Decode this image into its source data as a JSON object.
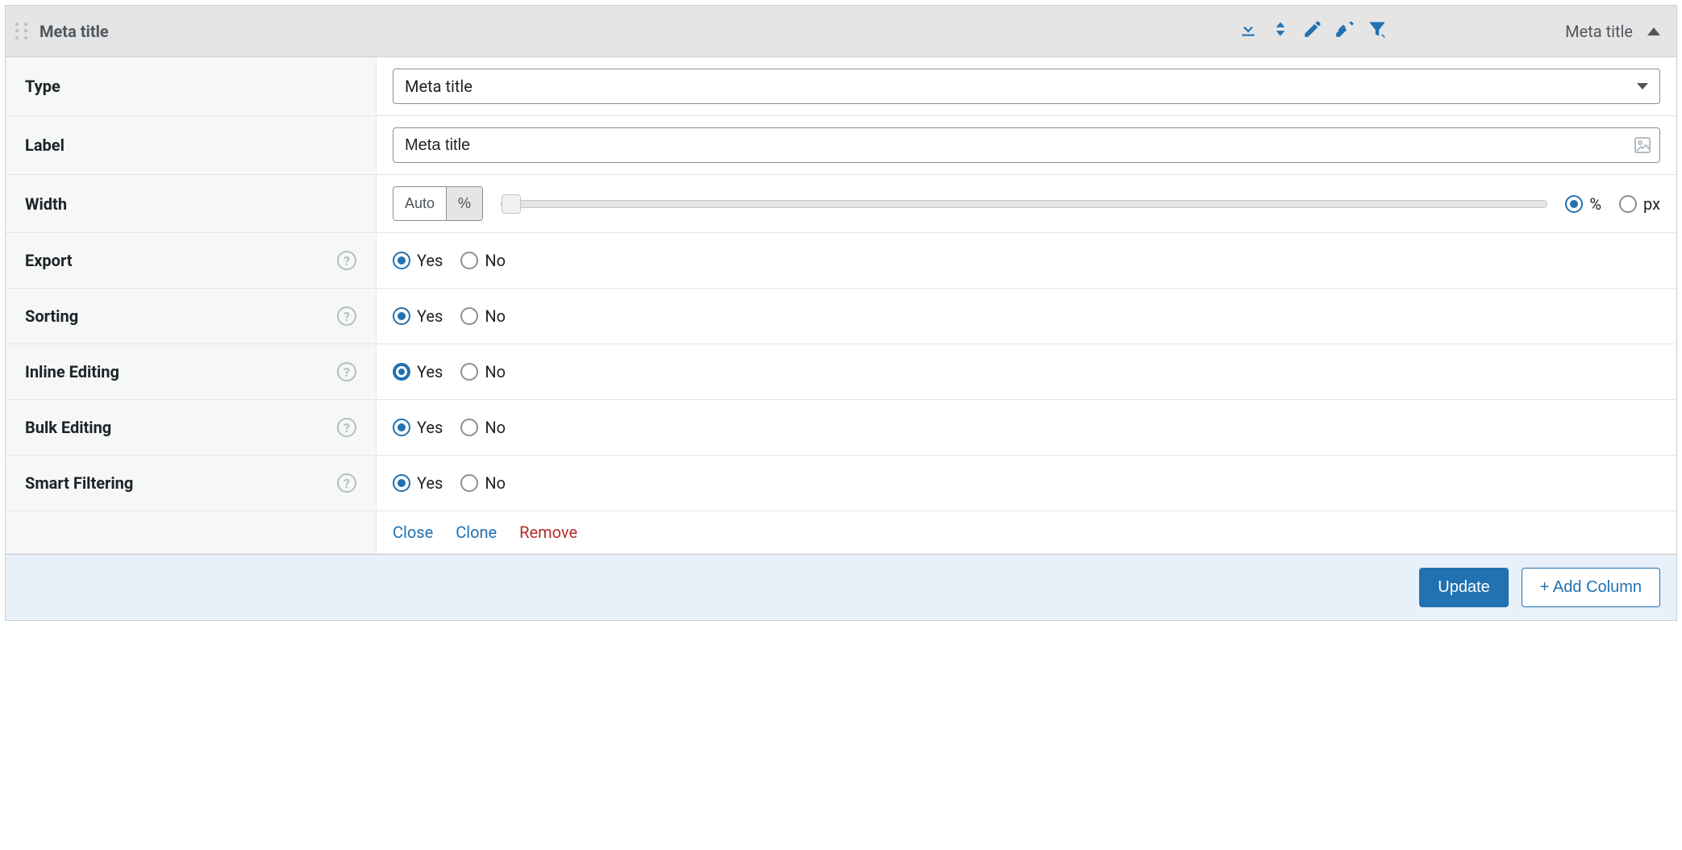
{
  "header": {
    "title_left": "Meta title",
    "title_right": "Meta title"
  },
  "rows": {
    "type": {
      "label": "Type",
      "value": "Meta title"
    },
    "label": {
      "label": "Label",
      "value": "Meta title"
    },
    "width": {
      "label": "Width",
      "btn_auto": "Auto",
      "btn_percent": "%",
      "unit_percent": "%",
      "unit_px": "px"
    },
    "export": {
      "label": "Export",
      "yes": "Yes",
      "no": "No"
    },
    "sorting": {
      "label": "Sorting",
      "yes": "Yes",
      "no": "No"
    },
    "inline": {
      "label": "Inline Editing",
      "yes": "Yes",
      "no": "No"
    },
    "bulk": {
      "label": "Bulk Editing",
      "yes": "Yes",
      "no": "No"
    },
    "smart": {
      "label": "Smart Filtering",
      "yes": "Yes",
      "no": "No"
    }
  },
  "actions": {
    "close": "Close",
    "clone": "Clone",
    "remove": "Remove"
  },
  "footer": {
    "update": "Update",
    "add_column": "+ Add Column"
  }
}
